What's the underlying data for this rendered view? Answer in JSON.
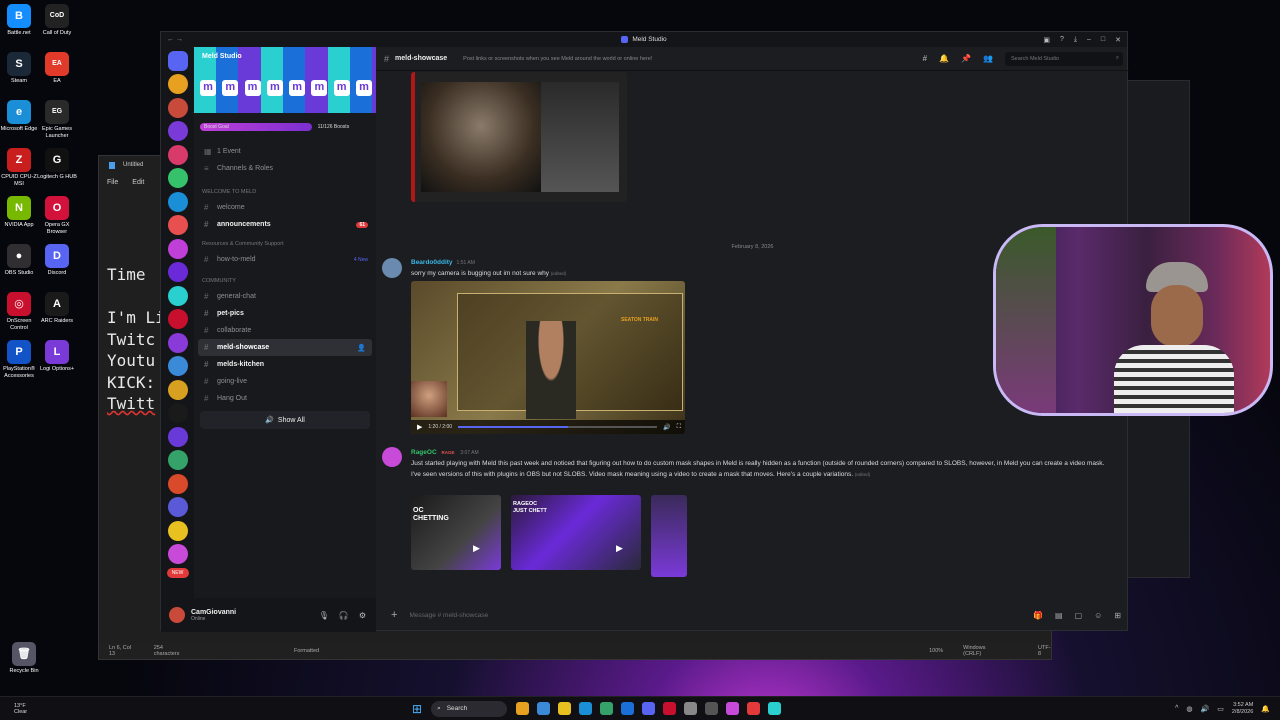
{
  "desktop": {
    "icons": [
      {
        "label": "Battle.net",
        "color": "#148eff",
        "glyph": "B"
      },
      {
        "label": "Call of Duty",
        "color": "#222222",
        "glyph": "CoD"
      },
      {
        "label": "Steam",
        "color": "#1b2838",
        "glyph": "S"
      },
      {
        "label": "EA",
        "color": "#e23a2a",
        "glyph": "EA"
      },
      {
        "label": "Microsoft Edge",
        "color": "#1a8fd8",
        "glyph": "e"
      },
      {
        "label": "Epic Games Launcher",
        "color": "#2a2a2a",
        "glyph": "EG"
      },
      {
        "label": "CPUID CPU-Z MSI",
        "color": "#c81e1e",
        "glyph": "Z"
      },
      {
        "label": "Logitech G HUB",
        "color": "#111111",
        "glyph": "G"
      },
      {
        "label": "NVIDIA App",
        "color": "#76b900",
        "glyph": "N"
      },
      {
        "label": "Opera GX Browser",
        "color": "#d2123a",
        "glyph": "O"
      },
      {
        "label": "OBS Studio",
        "color": "#302e31",
        "glyph": "●"
      },
      {
        "label": "Discord",
        "color": "#5865f2",
        "glyph": "D"
      },
      {
        "label": "OnScreen Control",
        "color": "#c8102e",
        "glyph": "◎"
      },
      {
        "label": "ARC Raiders",
        "color": "#1a1a1a",
        "glyph": "A"
      },
      {
        "label": "PlayStation® Accessories",
        "color": "#1254c8",
        "glyph": "P"
      },
      {
        "label": "Logi Options+",
        "color": "#7a3ad8",
        "glyph": "L"
      }
    ],
    "recycle_bin": "Recycle Bin"
  },
  "notepad": {
    "tab_title": "Untitled",
    "menu": [
      "File",
      "Edit"
    ],
    "lines": [
      "Time",
      "",
      "I'm Li",
      "Twitc",
      "Youtu",
      "KICK:",
      "Twitt"
    ],
    "status": [
      "Ln 6, Col 13",
      "254 characters",
      "Formatted",
      "100%",
      "Windows (CRLF)",
      "UTF-8"
    ]
  },
  "discord": {
    "window_title": "Meld Studio",
    "server_name": "Meld Studio",
    "boost_label": "Boost Goal",
    "boost_count": "11/126 Boosts",
    "boost_progress": 0.62,
    "top_items": [
      "1 Event",
      "Channels & Roles"
    ],
    "categories": {
      "welcome": "WELCOME TO MELD",
      "resources": "Resources & Community Support",
      "community": "COMMUNITY"
    },
    "channels_welcome": [
      {
        "name": "welcome",
        "bold": false,
        "badge": ""
      },
      {
        "name": "announcements",
        "bold": true,
        "badge": "61"
      }
    ],
    "channels_resources": [
      {
        "name": "how-to-meld",
        "bold": false,
        "badge": "",
        "tag": "4 New"
      }
    ],
    "channels_community": [
      {
        "name": "general-chat",
        "bold": false,
        "active": false
      },
      {
        "name": "pet-pics",
        "bold": true,
        "active": false
      },
      {
        "name": "collaborate",
        "bold": false,
        "active": false
      },
      {
        "name": "meld-showcase",
        "bold": true,
        "active": true
      },
      {
        "name": "melds-kitchen",
        "bold": true,
        "active": false
      },
      {
        "name": "going-live",
        "bold": false,
        "active": false
      },
      {
        "name": "Hang Out",
        "bold": false,
        "active": false
      }
    ],
    "show_all": "Show All",
    "user": {
      "name": "CamGiovanni",
      "status": "Online"
    },
    "header": {
      "channel": "meld-showcase",
      "topic": "Post links or screenshots when you see Meld around the world or online here!",
      "search_placeholder": "Search Meld Studio"
    },
    "date_divider": "February 8, 2026",
    "messages": [
      {
        "author": "Beardo0ddity",
        "author_color": "#3ab8e8",
        "time": "1:51 AM",
        "text": "sorry my camera is bugging out im not sure why",
        "edited": "(edited)"
      },
      {
        "author": "RageOC",
        "author_color": "#35c26a",
        "tag": "RAGE",
        "time": "3:07 AM",
        "text": "Just started playing with Meld this past week and noticed that figuring out how to do custom mask shapes in Meld is really hidden as a function (outside of rounded corners) compared to SLOBS, however, in Meld you can create a video mask. I've seen versions of this with plugins in OBS but not SLOBS. Video mask meaning using a video to create a mask that moves. Here's a couple variations.",
        "edited": "(edited)"
      }
    ],
    "video": {
      "time": "1:20 / 2:00",
      "progress": 0.55,
      "overlay_text": "SEATON TRAIN"
    },
    "thumbs": [
      "OC CHETTING",
      "RAGEOC JUST CHETT"
    ],
    "composer_placeholder": "Message # meld-showcase",
    "new_badge": "NEW"
  },
  "taskbar": {
    "weather_temp": "13°F",
    "weather_desc": "Clear",
    "search": "Search",
    "time": "3:52 AM",
    "date": "2/8/2026"
  },
  "colors": {
    "accent": "#5865f2",
    "discord_bg": "#1c1d21",
    "banner": [
      "#2ad0d0",
      "#1a6fd8",
      "#6a3ad8"
    ]
  }
}
